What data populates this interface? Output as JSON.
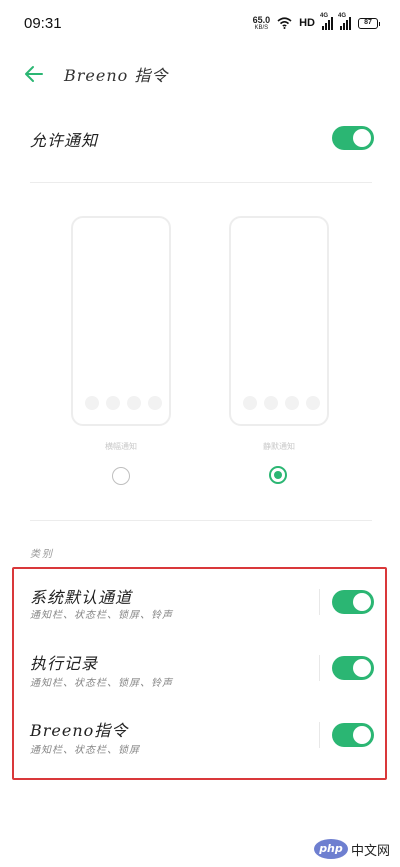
{
  "status_bar": {
    "time": "09:31",
    "speed_value": "65.0",
    "speed_unit": "KB/S",
    "hd_label": "HD",
    "sig1_label": "4G",
    "sig2_label": "4G",
    "battery": "87"
  },
  "header": {
    "title": "Breeno 指令"
  },
  "allow_notification": {
    "label": "允许通知",
    "enabled": true
  },
  "previews": [
    {
      "caption": "横幅通知",
      "selected": false
    },
    {
      "caption": "静默通知",
      "selected": true
    }
  ],
  "category": {
    "title": "类别",
    "items": [
      {
        "label": "系统默认通道",
        "sub": "通知栏、状态栏、锁屏、铃声",
        "enabled": true
      },
      {
        "label": "执行记录",
        "sub": "通知栏、状态栏、锁屏、铃声",
        "enabled": true
      },
      {
        "label": "Breeno指令",
        "sub": "通知栏、状态栏、锁屏",
        "enabled": true
      }
    ]
  },
  "watermark": {
    "logo": "php",
    "text": "中文网"
  },
  "colors": {
    "accent": "#2bb673",
    "highlight": "#d9383a"
  }
}
